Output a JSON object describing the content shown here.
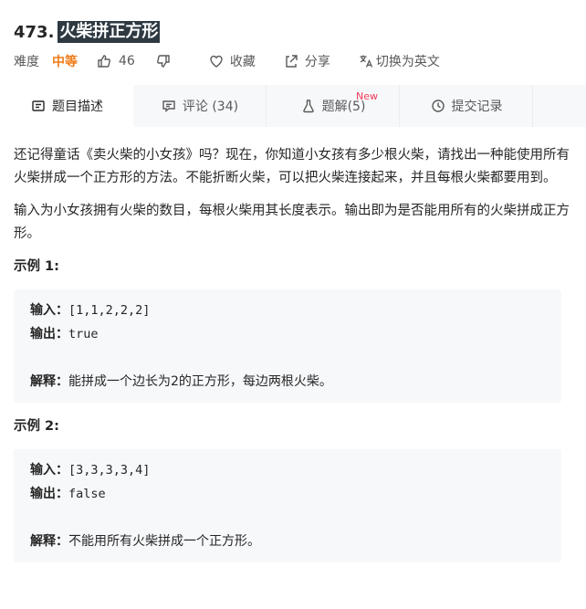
{
  "problem": {
    "number": "473.",
    "title": "火柴拼正方形"
  },
  "meta": {
    "difficulty_label": "难度",
    "difficulty_value": "中等",
    "likes": "46",
    "collect_label": "收藏",
    "share_label": "分享",
    "translate_label": "切换为英文"
  },
  "tabs": [
    {
      "label": "题目描述",
      "icon": "description-icon"
    },
    {
      "label": "评论 (34)",
      "icon": "comment-icon"
    },
    {
      "label": "题解(5)",
      "icon": "flask-icon",
      "badge": "New"
    },
    {
      "label": "提交记录",
      "icon": "clock-icon"
    }
  ],
  "description": {
    "para1": "还记得童话《卖火柴的小女孩》吗？现在，你知道小女孩有多少根火柴，请找出一种能使用所有火柴拼成一个正方形的方法。不能折断火柴，可以把火柴连接起来，并且每根火柴都要用到。",
    "para2": "输入为小女孩拥有火柴的数目，每根火柴用其长度表示。输出即为是否能用所有的火柴拼成正方形。"
  },
  "examples": [
    {
      "title": "示例 1:",
      "input_label": "输入：",
      "input": "[1,1,2,2,2]",
      "output_label": "输出：",
      "output": "true",
      "explain_label": "解释：",
      "explain": "能拼成一个边长为2的正方形，每边两根火柴。"
    },
    {
      "title": "示例 2:",
      "input_label": "输入：",
      "input": "[3,3,3,3,4]",
      "output_label": "输出：",
      "output": "false",
      "explain_label": "解释：",
      "explain": "不能用所有火柴拼成一个正方形。"
    }
  ],
  "colors": {
    "difficulty": "#ef7d1a",
    "new_badge": "#f03c5b",
    "title_highlight": "#2e3942"
  }
}
